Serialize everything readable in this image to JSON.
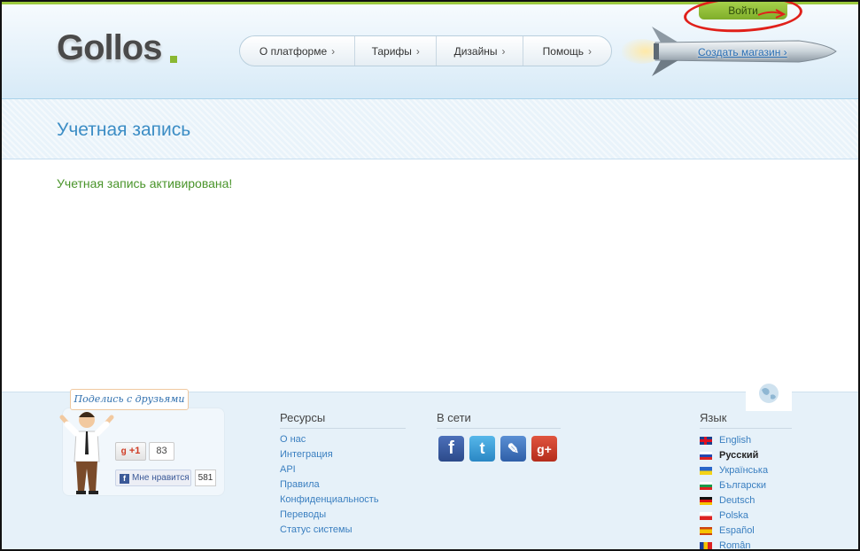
{
  "header": {
    "logo": "Gollos",
    "nav": [
      {
        "label": "О платформе"
      },
      {
        "label": "Тарифы"
      },
      {
        "label": "Дизайны"
      },
      {
        "label": "Помощь"
      }
    ],
    "login_label": "Войти",
    "create_shop_label": "Создать магазин ›"
  },
  "page": {
    "title": "Учетная запись",
    "message": "Учетная запись активирована!"
  },
  "footer": {
    "share": {
      "label": "Поделись с друзьями",
      "gplus_label": "+1",
      "gplus_count": "83",
      "fb_label": "Мне нравится",
      "fb_count": "581"
    },
    "resources": {
      "heading": "Ресурсы",
      "links": [
        "О нас",
        "Интеграция",
        "API",
        "Правила",
        "Конфиденциальность",
        "Переводы",
        "Статус системы"
      ]
    },
    "social": {
      "heading": "В сети",
      "icons": [
        "facebook-icon",
        "twitter-icon",
        "blog-icon",
        "google-plus-icon"
      ]
    },
    "language": {
      "heading": "Язык",
      "items": [
        {
          "label": "English",
          "flag": "uk-flag-icon"
        },
        {
          "label": "Русский",
          "flag": "ru-flag-icon",
          "active": true
        },
        {
          "label": "Українська",
          "flag": "ua-flag-icon"
        },
        {
          "label": "Български",
          "flag": "bg-flag-icon"
        },
        {
          "label": "Deutsch",
          "flag": "de-flag-icon"
        },
        {
          "label": "Polska",
          "flag": "pl-flag-icon"
        },
        {
          "label": "Español",
          "flag": "es-flag-icon"
        },
        {
          "label": "Român",
          "flag": "ro-flag-icon"
        }
      ]
    }
  },
  "colors": {
    "accent_green": "#8ab832",
    "link_blue": "#3a7fc0",
    "title_blue": "#3c8dc5",
    "success_green": "#49942a",
    "annotation_red": "#e0201a"
  }
}
